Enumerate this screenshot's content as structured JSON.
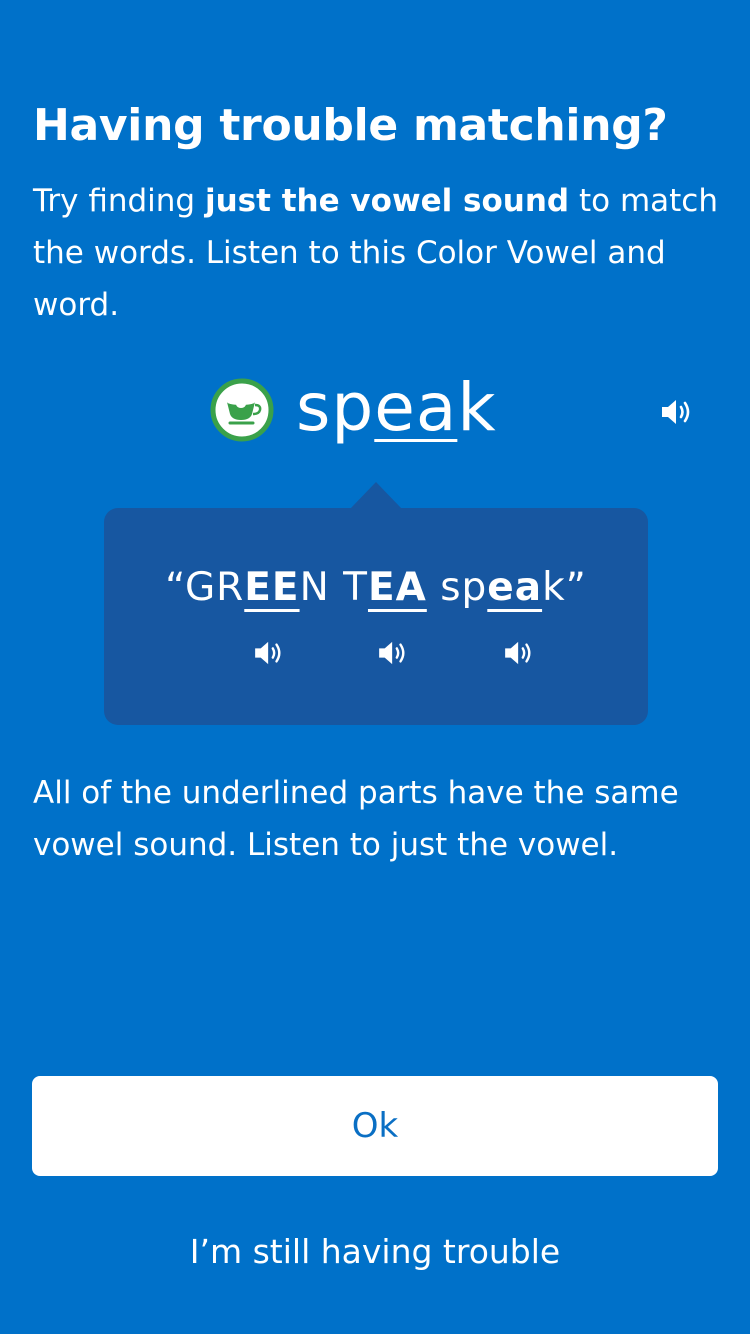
{
  "title": "Having trouble matching?",
  "intro": {
    "prefix": "Try finding ",
    "bold": "just the vowel sound",
    "suffix": " to match the words. Listen to this Color Vowel and word."
  },
  "word": {
    "before": "sp",
    "vowel": "ea",
    "after": "k",
    "icon": "green-tea-cup-icon",
    "icon_color": "#3aa14a"
  },
  "phrase": {
    "open_quote": "“",
    "w1_before": "GR",
    "w1_vowel": "EE",
    "w1_after": "N",
    "w2_before": "T",
    "w2_vowel": "EA",
    "w3_before": "sp",
    "w3_vowel": "ea",
    "w3_after": "k",
    "close_quote": "”"
  },
  "explain": "All of the underlined parts have the same vowel sound. Listen to just the vowel.",
  "buttons": {
    "ok": "Ok",
    "still_trouble": "I’m still having trouble"
  },
  "colors": {
    "background": "#0071c9",
    "card": "#1757a1",
    "button_text": "#0a6fc4"
  }
}
